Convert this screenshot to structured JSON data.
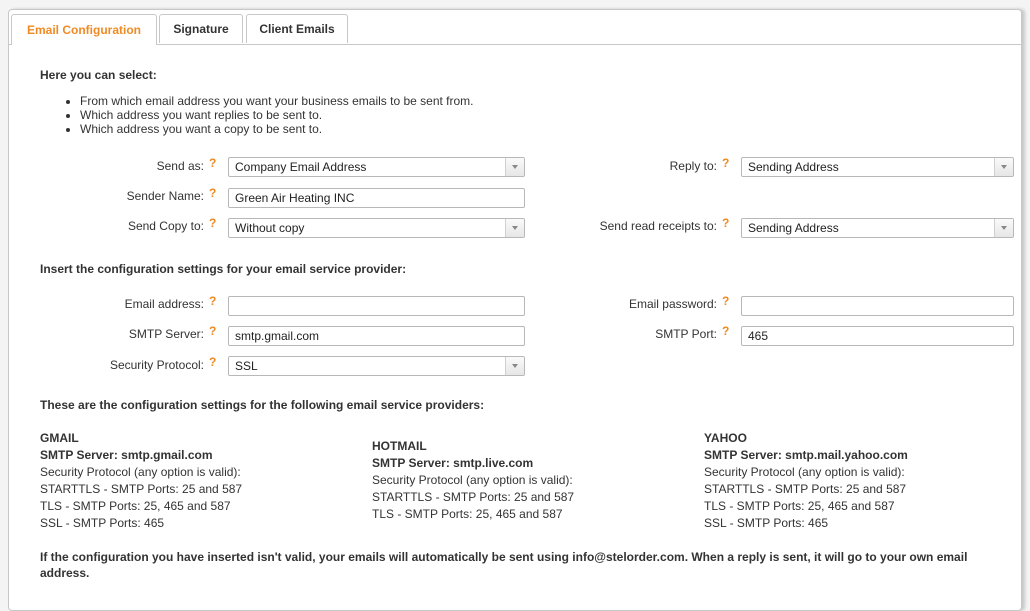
{
  "tabs": [
    {
      "label": "Email Configuration",
      "active": true
    },
    {
      "label": "Signature",
      "active": false
    },
    {
      "label": "Client Emails",
      "active": false
    }
  ],
  "intro": {
    "heading": "Here you can select:",
    "bullets": [
      "From which email address you want your business emails to be sent from.",
      "Which address you want replies to be sent to.",
      "Which address you want a copy to be sent to."
    ]
  },
  "help_glyph": "?",
  "sending": {
    "send_as": {
      "label": "Send as:",
      "value": "Company Email Address"
    },
    "sender_name": {
      "label": "Sender Name:",
      "value": "Green Air Heating INC"
    },
    "send_copy_to": {
      "label": "Send Copy to:",
      "value": "Without copy"
    },
    "reply_to": {
      "label": "Reply to:",
      "value": "Sending Address"
    },
    "read_receipts_to": {
      "label": "Send read receipts to:",
      "value": "Sending Address"
    }
  },
  "provider_config": {
    "heading": "Insert the configuration settings for your email service provider:",
    "email_address": {
      "label": "Email address:",
      "value": ""
    },
    "smtp_server": {
      "label": "SMTP Server:",
      "value": "smtp.gmail.com"
    },
    "security_protocol": {
      "label": "Security Protocol:",
      "value": "SSL"
    },
    "email_password": {
      "label": "Email password:",
      "value": ""
    },
    "smtp_port": {
      "label": "SMTP Port:",
      "value": "465"
    }
  },
  "providers": {
    "heading": "These are the configuration settings for the following email service providers:",
    "list": [
      {
        "name": "GMAIL",
        "server": "SMTP Server: smtp.gmail.com",
        "lines": [
          "Security Protocol (any option is valid):",
          "STARTTLS - SMTP Ports: 25 and 587",
          "TLS - SMTP Ports: 25, 465 and 587",
          "SSL - SMTP Ports: 465"
        ]
      },
      {
        "name": "HOTMAIL",
        "server": "SMTP Server: smtp.live.com",
        "lines": [
          "Security Protocol (any option is valid):",
          "STARTTLS - SMTP Ports: 25 and 587",
          "TLS - SMTP Ports: 25, 465 and 587"
        ]
      },
      {
        "name": "YAHOO",
        "server": "SMTP Server: smtp.mail.yahoo.com",
        "lines": [
          "Security Protocol (any option is valid):",
          "STARTTLS - SMTP Ports: 25 and 587",
          "TLS - SMTP Ports: 25, 465 and 587",
          "SSL - SMTP Ports: 465"
        ]
      }
    ]
  },
  "footer_note": "If the configuration you have inserted isn't valid, your emails will automatically be sent using info@stelorder.com. When a reply is sent, it will go to your own email address.",
  "colors": {
    "accent": "#f08a24",
    "text": "#333333",
    "border": "#c8c8c8"
  }
}
